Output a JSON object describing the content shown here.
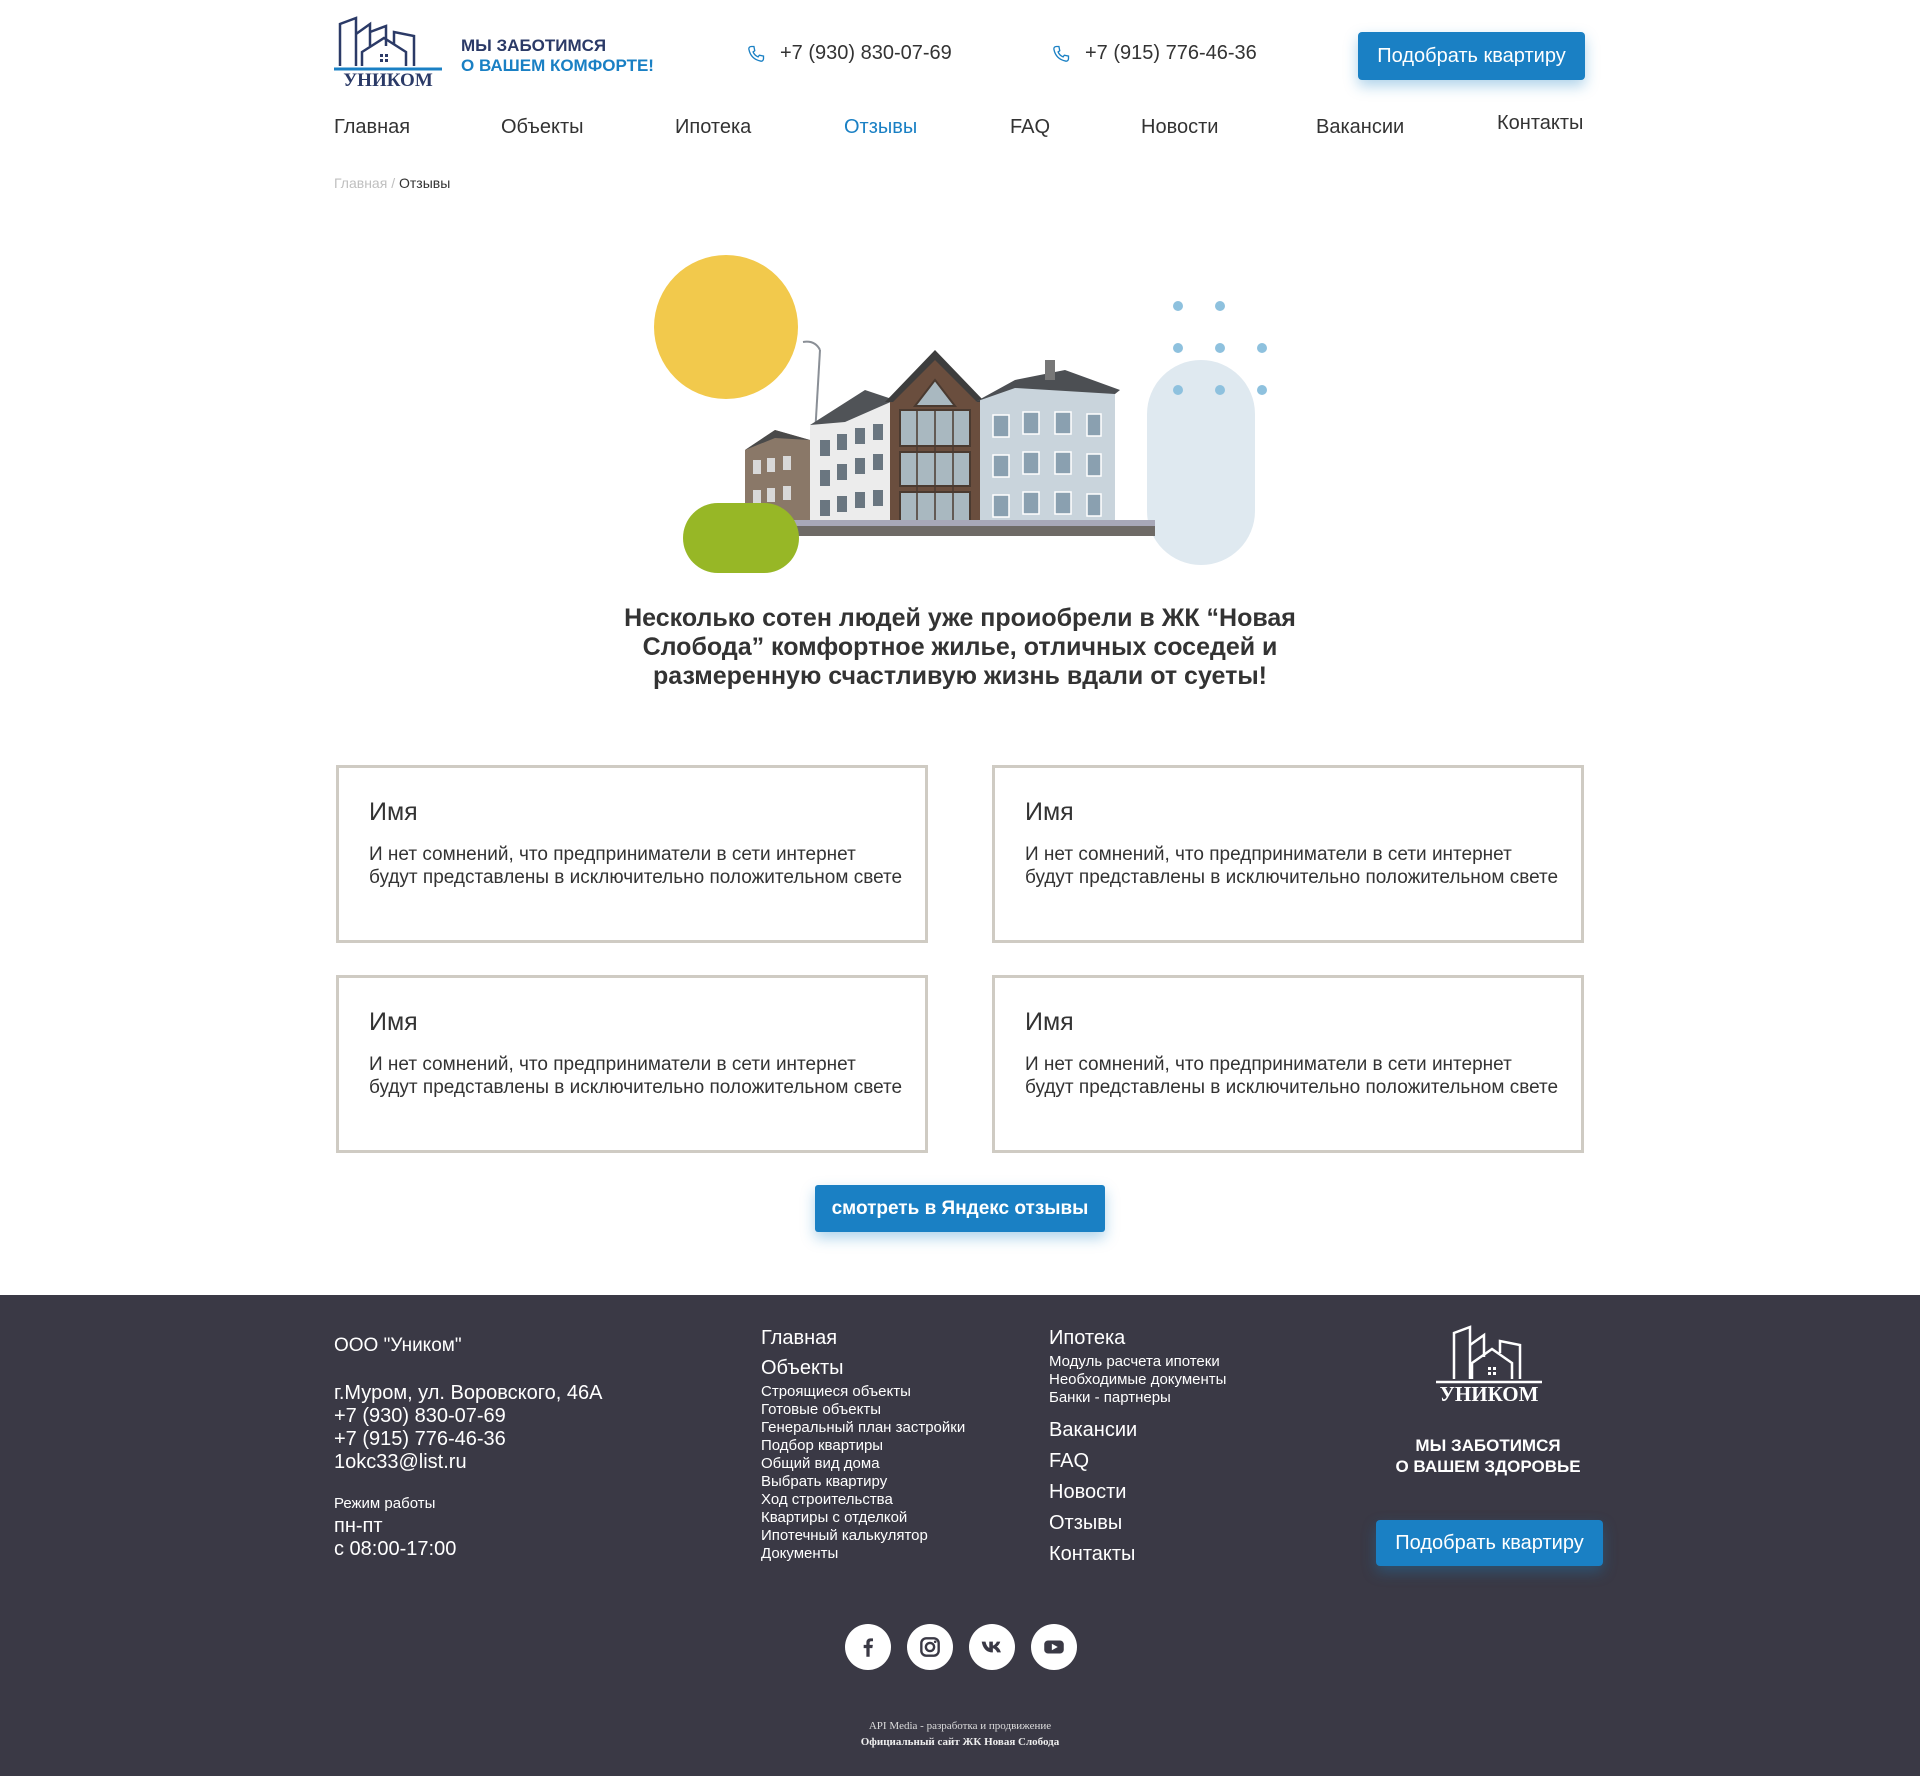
{
  "header": {
    "logo_text": "УНИКОМ",
    "tagline_line1": "МЫ ЗАБОТИМСЯ",
    "tagline_line2": "О ВАШЕМ КОМФОРТЕ!",
    "phone1": "+7 (930) 830-07-69",
    "phone2": "+7 (915) 776-46-36",
    "cta_label": "Подобрать квартиру",
    "phone_icon": "phone-icon"
  },
  "nav": {
    "items": [
      {
        "label": "Главная",
        "active": false
      },
      {
        "label": "Объекты",
        "active": false
      },
      {
        "label": "Ипотека",
        "active": false
      },
      {
        "label": "Отзывы",
        "active": true
      },
      {
        "label": "FAQ",
        "active": false
      },
      {
        "label": "Новости",
        "active": false
      },
      {
        "label": "Вакансии",
        "active": false
      },
      {
        "label": "Контакты",
        "active": false
      }
    ]
  },
  "breadcrumb": {
    "home": "Главная",
    "separator": "/",
    "current": "Отзывы"
  },
  "hero": {
    "text": "Несколько сотен людей уже проиобрели в ЖК “Новая Слобода” комфортное жилье, отличных соседей и размеренную счастливую жизнь вдали от суеты!"
  },
  "reviews": [
    {
      "name": "Имя",
      "text": "И нет сомнений, что предприниматели в сети интернет будут представлены в исключительно положительном свете"
    },
    {
      "name": "Имя",
      "text": "И нет сомнений, что предприниматели в сети интернет будут представлены в исключительно положительном свете"
    },
    {
      "name": "Имя",
      "text": "И нет сомнений, что предприниматели в сети интернет будут представлены в исключительно положительном свете"
    },
    {
      "name": "Имя",
      "text": "И нет сомнений, что предприниматели в сети интернет будут представлены в исключительно положительном свете"
    }
  ],
  "yandex_button": "смотреть в Яндекс отзывы",
  "footer": {
    "company": "ООО \"Уником\"",
    "address": "г.Муром, ул. Воровского, 46А",
    "phone1": "+7 (930) 830-07-69",
    "phone2": "+7 (915) 776-46-36",
    "email": "1okc33@list.ru",
    "hours_label": "Режим работы",
    "hours_days": "пн-пт",
    "hours_time": "с 08:00-17:00",
    "col1": {
      "main": "Главная",
      "objects": "Объекты",
      "sub": [
        "Строящиеся объекты",
        "Готовые объекты",
        "Генеральный план застройки",
        "Подбор квартиры",
        "Общий вид дома",
        "Выбрать квартиру",
        "Ход строительства",
        "Квартиры с отделкой",
        "Ипотечный калькулятор",
        "Документы"
      ]
    },
    "col2": {
      "mortgage": "Ипотека",
      "sub": [
        "Модуль расчета ипотеки",
        "Необходимые документы",
        "Банки - партнеры"
      ],
      "links": [
        "Вакансии",
        "FAQ",
        "Новости",
        "Отзывы",
        "Контакты"
      ]
    },
    "logo_text": "УНИКОМ",
    "tagline_line1": "МЫ ЗАБОТИМСЯ",
    "tagline_line2": "О ВАШЕМ ЗДОРОВЬЕ",
    "cta_label": "Подобрать квартиру",
    "socials": [
      "facebook-icon",
      "instagram-icon",
      "vk-icon",
      "youtube-icon"
    ],
    "credit1": "API Media - разработка и продвижение",
    "credit2": "Официальный сайт ЖК Новая Слобода"
  },
  "colors": {
    "accent": "#1a80c4",
    "navy": "#2b3a67",
    "footer_bg": "#3a3945",
    "yellow": "#f2c94c",
    "green": "#97b726",
    "light_blue": "#dfe9f0",
    "card_border": "#cfcbc3"
  }
}
